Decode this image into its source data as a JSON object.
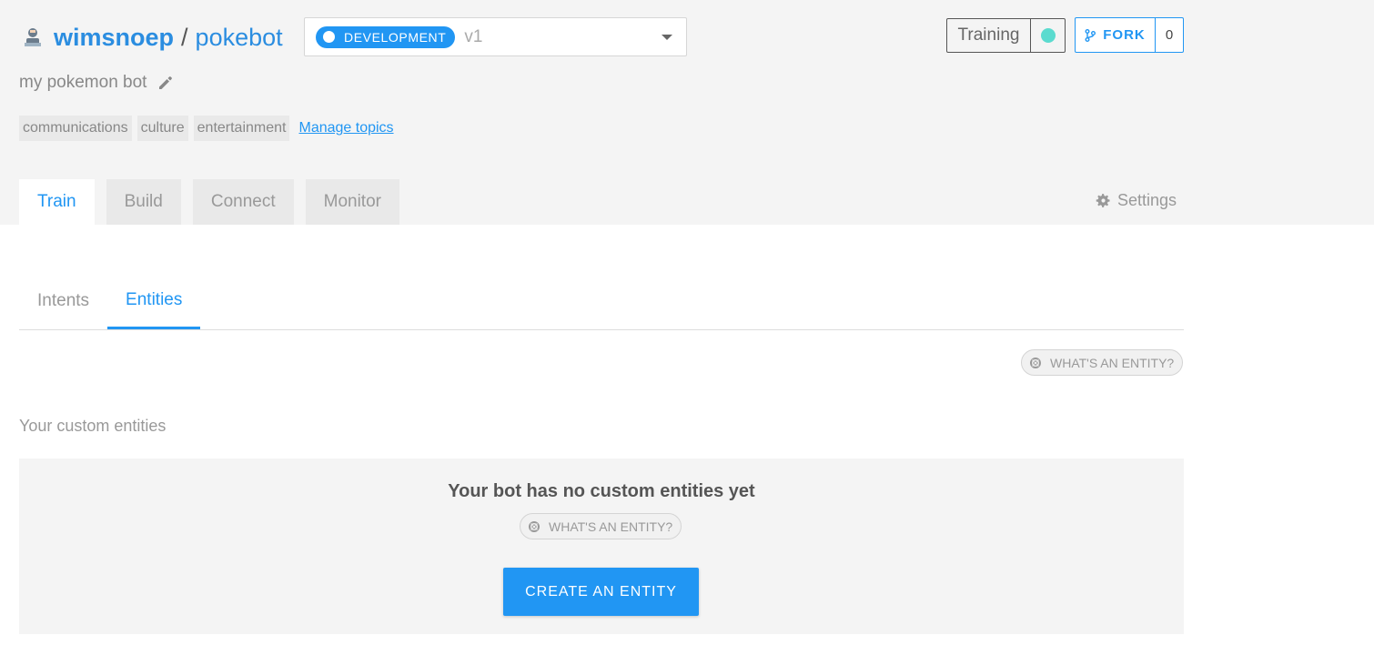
{
  "header": {
    "owner": "wimsnoep",
    "separator": "/",
    "bot_name": "pokebot",
    "environment": "DEVELOPMENT",
    "version": "v1",
    "training_label": "Training",
    "fork_label": "FORK",
    "fork_count": "0",
    "description": "my pokemon bot",
    "topics": [
      "communications",
      "culture",
      "entertainment"
    ],
    "manage_topics": "Manage topics"
  },
  "main_tabs": [
    {
      "label": "Train",
      "active": true
    },
    {
      "label": "Build",
      "active": false
    },
    {
      "label": "Connect",
      "active": false
    },
    {
      "label": "Monitor",
      "active": false
    }
  ],
  "settings_label": "Settings",
  "sub_tabs": [
    {
      "label": "Intents",
      "active": false
    },
    {
      "label": "Entities",
      "active": true
    }
  ],
  "help_label": "WHAT'S AN ENTITY?",
  "section_title": "Your custom entities",
  "empty_state": {
    "title": "Your bot has no custom entities yet",
    "help_label": "WHAT'S AN ENTITY?",
    "button_label": "CREATE AN ENTITY"
  },
  "colors": {
    "accent": "#2196f3",
    "training_status": "#5bdbcf",
    "background_panel": "#f4f4f4"
  },
  "icons": {
    "avatar": "user-avatar-icon",
    "fork": "fork-icon",
    "edit": "pencil-icon",
    "settings": "gear-icon",
    "help": "lifebuoy-icon",
    "dropdown": "caret-down-icon"
  }
}
